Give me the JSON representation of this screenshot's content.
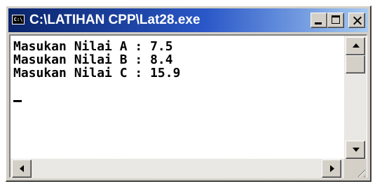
{
  "window": {
    "title": "C:\\LATIHAN CPP\\Lat28.exe",
    "icon": "console-icon",
    "icon_text": "C:\\",
    "controls": {
      "minimize": "minimize-icon",
      "maximize": "maximize-icon",
      "close": "close-icon"
    }
  },
  "console": {
    "lines": [
      "Masukan Nilai A : 7.5",
      "Masukan Nilai B : 8.4",
      "Masukan Nilai C : 15.9"
    ]
  },
  "colors": {
    "titlebar_start": "#0a246a",
    "titlebar_end": "#a6caf0",
    "console_bg": "#ffffff",
    "console_text": "#000000",
    "chrome": "#d4d0c8"
  }
}
